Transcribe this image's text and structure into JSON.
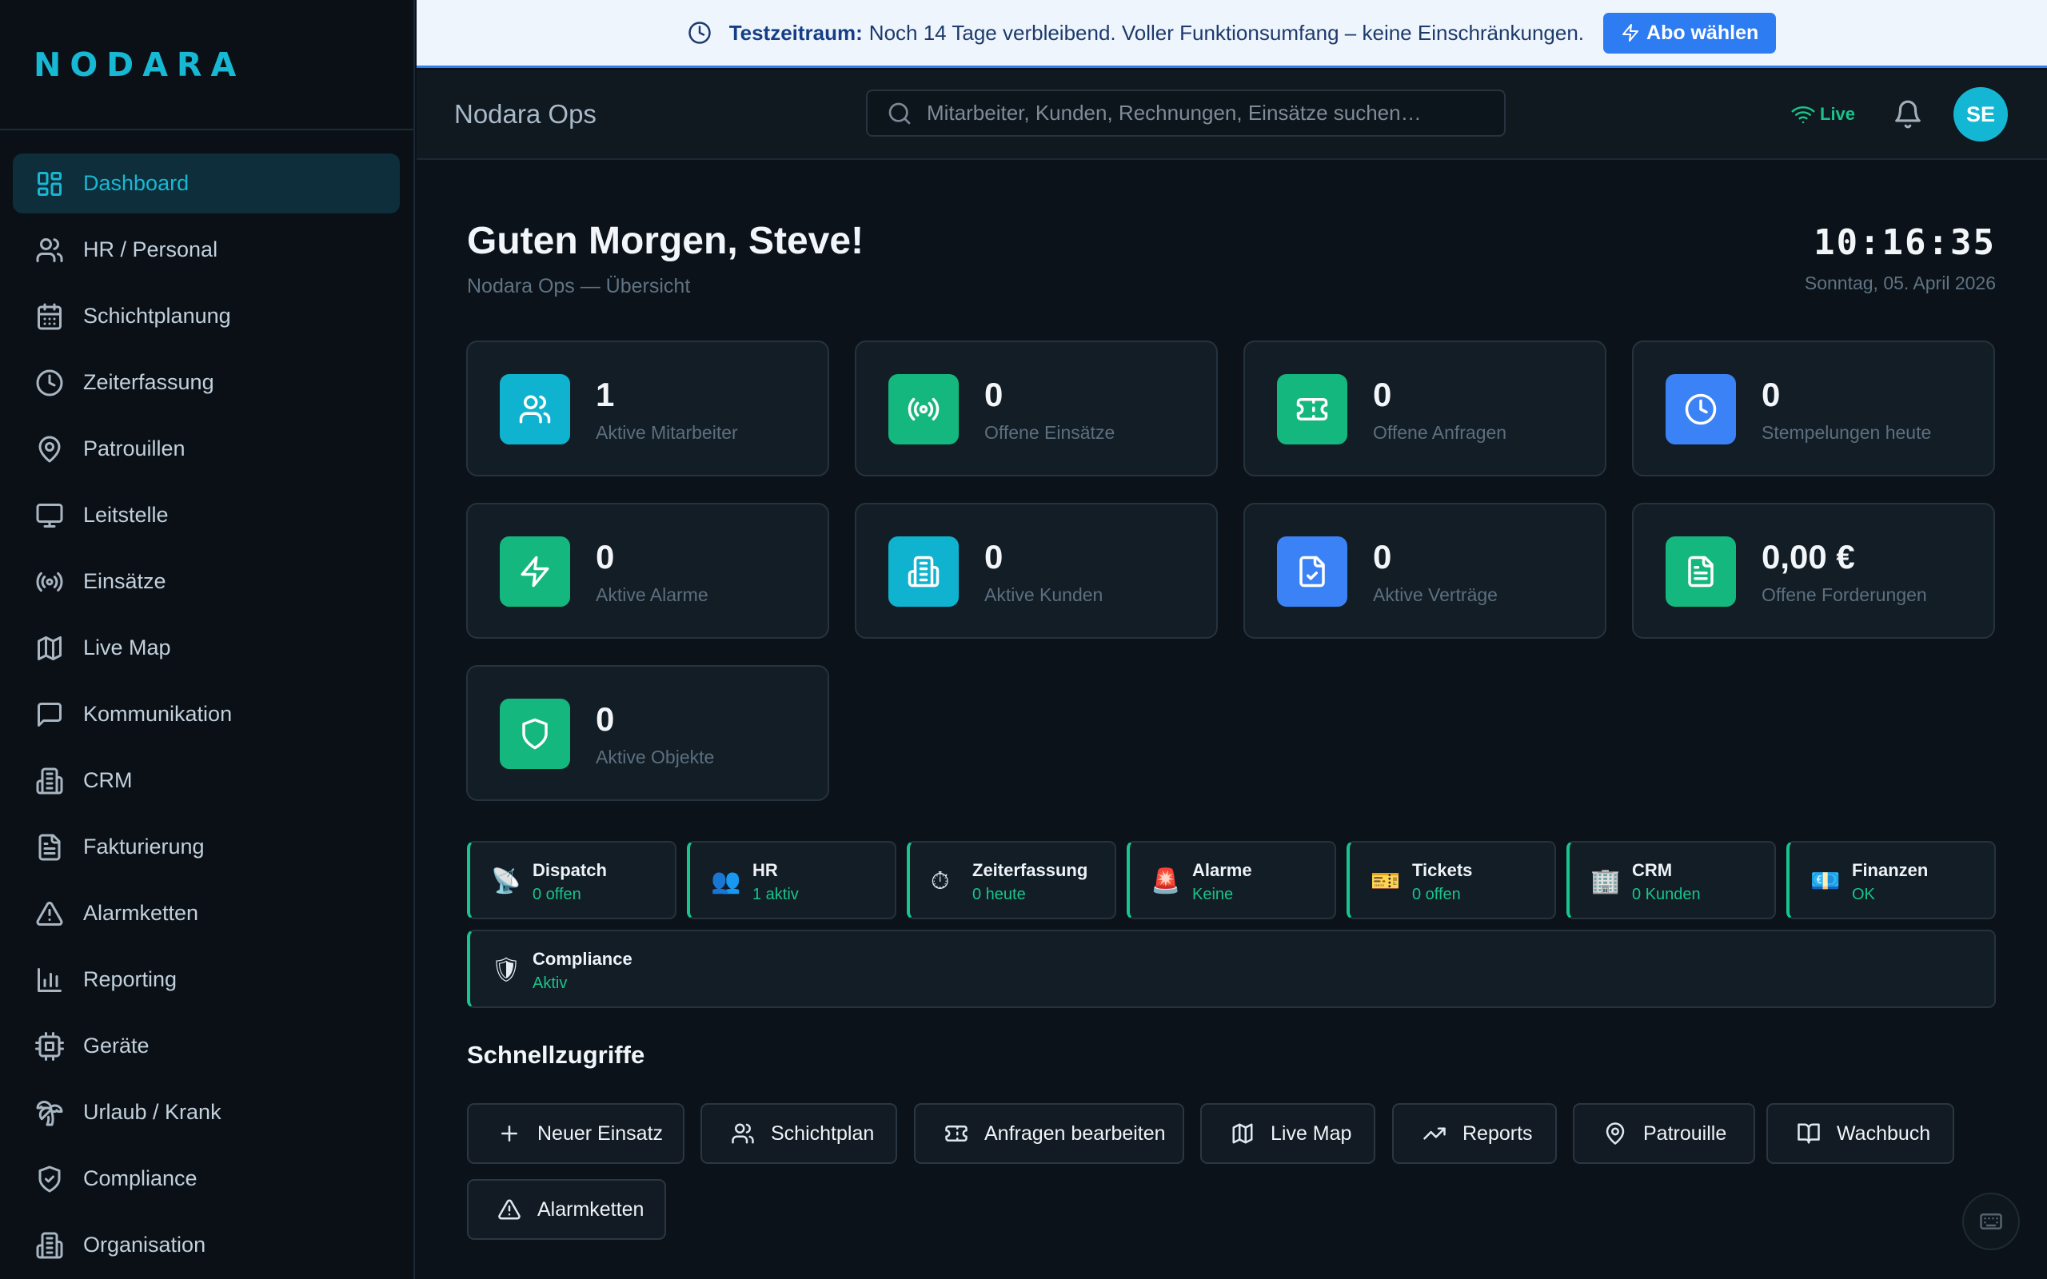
{
  "brand": {
    "logo_text": "NODARA",
    "accent": "#17b8d4"
  },
  "sidebar": {
    "items": [
      {
        "label": "Dashboard",
        "icon": "grid-icon",
        "active": true
      },
      {
        "label": "HR / Personal",
        "icon": "users-icon"
      },
      {
        "label": "Schichtplanung",
        "icon": "calendar-icon"
      },
      {
        "label": "Zeiterfassung",
        "icon": "clock-icon"
      },
      {
        "label": "Patrouillen",
        "icon": "map-pin-icon"
      },
      {
        "label": "Leitstelle",
        "icon": "monitor-icon"
      },
      {
        "label": "Einsätze",
        "icon": "radio-icon"
      },
      {
        "label": "Live Map",
        "icon": "map-icon"
      },
      {
        "label": "Kommunikation",
        "icon": "chat-icon"
      },
      {
        "label": "CRM",
        "icon": "building-icon"
      },
      {
        "label": "Fakturierung",
        "icon": "file-text-icon"
      },
      {
        "label": "Alarmketten",
        "icon": "alert-triangle-icon"
      },
      {
        "label": "Reporting",
        "icon": "bar-chart-icon"
      },
      {
        "label": "Geräte",
        "icon": "cpu-icon"
      },
      {
        "label": "Urlaub / Krank",
        "icon": "palm-tree-icon"
      },
      {
        "label": "Compliance",
        "icon": "shield-check-icon"
      },
      {
        "label": "Organisation",
        "icon": "building-icon"
      }
    ]
  },
  "banner": {
    "title": "Testzeitraum:",
    "text": "Noch 14 Tage verbleibend. Voller Funktionsumfang – keine Einschränkungen.",
    "button": "Abo wählen",
    "icon": "clock-icon",
    "button_icon": "bolt-icon"
  },
  "topbar": {
    "app_name": "Nodara Ops",
    "search_placeholder": "Mitarbeiter, Kunden, Rechnungen, Einsätze suchen…",
    "live_label": "Live",
    "avatar_initials": "SE"
  },
  "header": {
    "greeting": "Guten Morgen, Steve!",
    "subtitle": "Nodara Ops — Übersicht",
    "time": "10:16:35",
    "date": "Sonntag, 05. April 2026"
  },
  "stats": [
    {
      "value": "1",
      "label": "Aktive Mitarbeiter",
      "icon": "users-icon",
      "color": "#0fb3cf"
    },
    {
      "value": "0",
      "label": "Offene Einsätze",
      "icon": "radio-icon",
      "color": "#14b77e"
    },
    {
      "value": "0",
      "label": "Offene Anfragen",
      "icon": "ticket-icon",
      "color": "#14b77e"
    },
    {
      "value": "0",
      "label": "Stempelungen heute",
      "icon": "clock-icon",
      "color": "#3b82f6"
    },
    {
      "value": "0",
      "label": "Aktive Alarme",
      "icon": "bolt-icon",
      "color": "#14b77e"
    },
    {
      "value": "0",
      "label": "Aktive Kunden",
      "icon": "building-icon",
      "color": "#0fb3cf"
    },
    {
      "value": "0",
      "label": "Aktive Verträge",
      "icon": "file-check-icon",
      "color": "#3b82f6"
    },
    {
      "value": "0,00 €",
      "label": "Offene Forderungen",
      "icon": "file-text-icon",
      "color": "#14b77e"
    },
    {
      "value": "0",
      "label": "Aktive Objekte",
      "icon": "shield-icon",
      "color": "#14b77e"
    }
  ],
  "status_tiles": [
    {
      "title": "Dispatch",
      "value": "0 offen",
      "emoji": "📡"
    },
    {
      "title": "HR",
      "value": "1 aktiv",
      "emoji": "👥"
    },
    {
      "title": "Zeiterfassung",
      "value": "0 heute",
      "emoji": "⏱"
    },
    {
      "title": "Alarme",
      "value": "Keine",
      "emoji": "🚨"
    },
    {
      "title": "Tickets",
      "value": "0 offen",
      "emoji": "🎫"
    },
    {
      "title": "CRM",
      "value": "0 Kunden",
      "emoji": "🏢"
    },
    {
      "title": "Finanzen",
      "value": "OK",
      "emoji": "💶"
    },
    {
      "title": "Compliance",
      "value": "Aktiv",
      "emoji": "🛡"
    }
  ],
  "quick": {
    "title": "Schnellzugriffe",
    "buttons": [
      {
        "label": "Neuer Einsatz",
        "icon": "plus-icon"
      },
      {
        "label": "Schichtplan",
        "icon": "users-icon"
      },
      {
        "label": "Anfragen bearbeiten",
        "icon": "ticket-icon"
      },
      {
        "label": "Live Map",
        "icon": "map-icon"
      },
      {
        "label": "Reports",
        "icon": "trending-up-icon"
      },
      {
        "label": "Patrouille",
        "icon": "map-pin-icon"
      },
      {
        "label": "Wachbuch",
        "icon": "book-open-icon"
      },
      {
        "label": "Alarmketten",
        "icon": "alert-triangle-icon"
      }
    ]
  }
}
